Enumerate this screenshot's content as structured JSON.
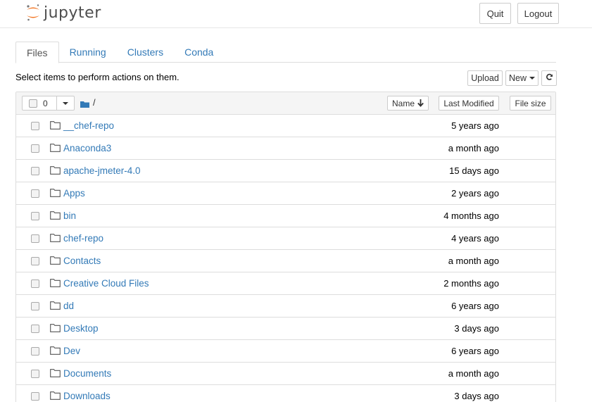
{
  "header": {
    "logo_text": "jupyter",
    "quit_label": "Quit",
    "logout_label": "Logout"
  },
  "tabs": [
    {
      "label": "Files",
      "active": true
    },
    {
      "label": "Running",
      "active": false
    },
    {
      "label": "Clusters",
      "active": false
    },
    {
      "label": "Conda",
      "active": false
    }
  ],
  "toolbar": {
    "hint": "Select items to perform actions on them.",
    "upload_label": "Upload",
    "new_label": "New"
  },
  "list_header": {
    "selected_count": "0",
    "breadcrumb": "/",
    "name_label": "Name",
    "modified_label": "Last Modified",
    "size_label": "File size"
  },
  "items": [
    {
      "name": "__chef-repo",
      "modified": "5 years ago"
    },
    {
      "name": "Anaconda3",
      "modified": "a month ago"
    },
    {
      "name": "apache-jmeter-4.0",
      "modified": "15 days ago"
    },
    {
      "name": "Apps",
      "modified": "2 years ago"
    },
    {
      "name": "bin",
      "modified": "4 months ago"
    },
    {
      "name": "chef-repo",
      "modified": "4 years ago"
    },
    {
      "name": "Contacts",
      "modified": "a month ago"
    },
    {
      "name": "Creative Cloud Files",
      "modified": "2 months ago"
    },
    {
      "name": "dd",
      "modified": "6 years ago"
    },
    {
      "name": "Desktop",
      "modified": "3 days ago"
    },
    {
      "name": "Dev",
      "modified": "6 years ago"
    },
    {
      "name": "Documents",
      "modified": "a month ago"
    },
    {
      "name": "Downloads",
      "modified": "3 days ago"
    }
  ],
  "colors": {
    "link": "#337ab7",
    "logo_orange": "#f37726",
    "logo_gray": "#767677"
  },
  "icons": {
    "item": "folder-icon",
    "breadcrumb": "folder-solid-icon",
    "refresh": "refresh-icon",
    "sort": "arrow-down-icon"
  }
}
